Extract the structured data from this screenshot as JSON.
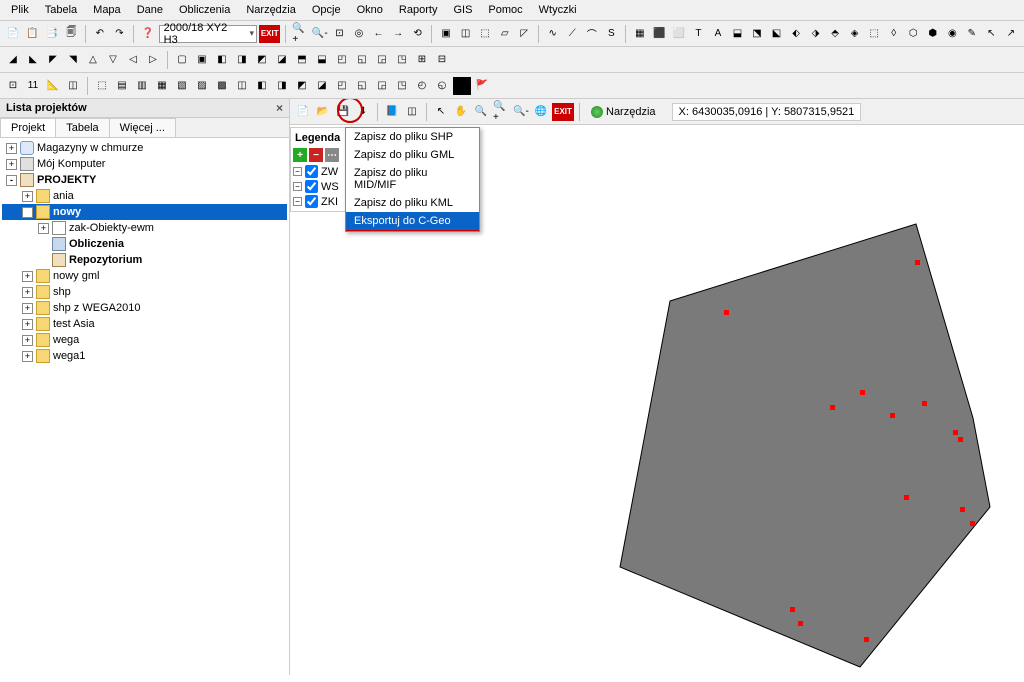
{
  "menu": [
    "Plik",
    "Tabela",
    "Mapa",
    "Dane",
    "Obliczenia",
    "Narzędzia",
    "Opcje",
    "Okno",
    "Raporty",
    "GIS",
    "Pomoc",
    "Wtyczki"
  ],
  "combo1": "2000/18 XY2 H3",
  "exit_label": "EXIT",
  "sidebar": {
    "title": "Lista projektów",
    "tabs": [
      "Projekt",
      "Tabela",
      "Więcej ..."
    ],
    "tree": [
      {
        "lvl": 0,
        "exp": "+",
        "icon": "cloud-icon",
        "label": "Magazyny w chmurze"
      },
      {
        "lvl": 0,
        "exp": "+",
        "icon": "pc-icon",
        "label": "Mój Komputer"
      },
      {
        "lvl": 0,
        "exp": "-",
        "icon": "book-icon",
        "label": "PROJEKTY",
        "bold": true
      },
      {
        "lvl": 1,
        "exp": "+",
        "icon": "folder-icon",
        "label": "ania"
      },
      {
        "lvl": 1,
        "exp": "-",
        "icon": "folder-icon",
        "label": "nowy",
        "bold": true,
        "selected": true
      },
      {
        "lvl": 2,
        "exp": "+",
        "icon": "page-icon",
        "label": "zak-Obiekty-ewm"
      },
      {
        "lvl": 2,
        "exp": "",
        "icon": "gear-icon",
        "label": "Obliczenia",
        "bold": true
      },
      {
        "lvl": 2,
        "exp": "",
        "icon": "book-icon",
        "label": "Repozytorium",
        "bold": true
      },
      {
        "lvl": 1,
        "exp": "+",
        "icon": "folder-icon",
        "label": "nowy gml"
      },
      {
        "lvl": 1,
        "exp": "+",
        "icon": "folder-icon",
        "label": "shp"
      },
      {
        "lvl": 1,
        "exp": "+",
        "icon": "folder-icon",
        "label": "shp z WEGA2010"
      },
      {
        "lvl": 1,
        "exp": "+",
        "icon": "folder-icon",
        "label": "test Asia"
      },
      {
        "lvl": 1,
        "exp": "+",
        "icon": "folder-icon",
        "label": "wega"
      },
      {
        "lvl": 1,
        "exp": "+",
        "icon": "folder-icon",
        "label": "wega1"
      }
    ]
  },
  "legend": {
    "title": "Legenda",
    "items": [
      "ZW",
      "WS",
      "ZKI"
    ]
  },
  "dropdown": {
    "items": [
      {
        "label": "Zapisz do pliku SHP"
      },
      {
        "label": "Zapisz do pliku GML"
      },
      {
        "label": "Zapisz do pliku MID/MIF"
      },
      {
        "label": "Zapisz do pliku KML"
      },
      {
        "label": "Eksportuj do C-Geo",
        "selected": true
      }
    ]
  },
  "tools_label": "Narzędzia",
  "coords": "X: 6430035,0916 | Y: 5807315,9521",
  "icons_row1": [
    "📄",
    "📋",
    "📑",
    "🗐",
    "↶",
    "↷",
    "❓",
    "🔍+",
    "🔍-",
    "⊡",
    "◎",
    "←",
    "→",
    "⟲",
    "▣",
    "◫",
    "⬚",
    "▱",
    "◸",
    "∿",
    "⟋",
    "⌒",
    "S",
    "▦",
    "⬛",
    "⬜",
    "T",
    "A",
    "⬓",
    "⬔",
    "⬕",
    "⬖",
    "⬗",
    "⬘",
    "◈",
    "⬚",
    "◊",
    "⬡",
    "⬢",
    "◉",
    "✎",
    "↖",
    "↗"
  ],
  "icons_row2": [
    "◢",
    "◣",
    "◤",
    "◥",
    "△",
    "▽",
    "◁",
    "▷",
    "▢",
    "▣",
    "◧",
    "◨",
    "◩",
    "◪",
    "⬒",
    "⬓",
    "◰",
    "◱",
    "◲",
    "◳",
    "⊞",
    "⊟"
  ],
  "icons_row3": [
    "⊡",
    "11",
    "📐",
    "◫",
    "⬚",
    "▤",
    "▥",
    "▦",
    "▧",
    "▨",
    "▩",
    "◫",
    "◧",
    "◨",
    "◩",
    "◪",
    "◰",
    "◱",
    "◲",
    "◳",
    "◴",
    "◵",
    "⬛",
    "🚩"
  ],
  "icons_maptb": [
    "📄",
    "📂",
    "💾",
    "⬇",
    "📘",
    "◫"
  ]
}
